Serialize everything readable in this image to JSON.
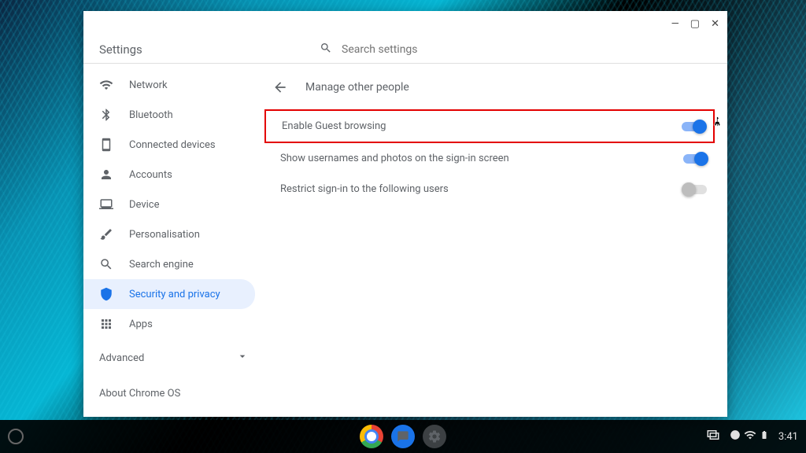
{
  "header": {
    "title": "Settings",
    "search_placeholder": "Search settings"
  },
  "sidebar": {
    "items": [
      {
        "label": "Network"
      },
      {
        "label": "Bluetooth"
      },
      {
        "label": "Connected devices"
      },
      {
        "label": "Accounts"
      },
      {
        "label": "Device"
      },
      {
        "label": "Personalisation"
      },
      {
        "label": "Search engine"
      },
      {
        "label": "Security and privacy"
      },
      {
        "label": "Apps"
      }
    ],
    "advanced": "Advanced",
    "about": "About Chrome OS"
  },
  "content": {
    "title": "Manage other people",
    "rows": [
      {
        "label": "Enable Guest browsing",
        "state": "on",
        "highlighted": true
      },
      {
        "label": "Show usernames and photos on the sign-in screen",
        "state": "on"
      },
      {
        "label": "Restrict sign-in to the following users",
        "state": "disabled"
      }
    ]
  },
  "taskbar": {
    "time": "3:41"
  }
}
